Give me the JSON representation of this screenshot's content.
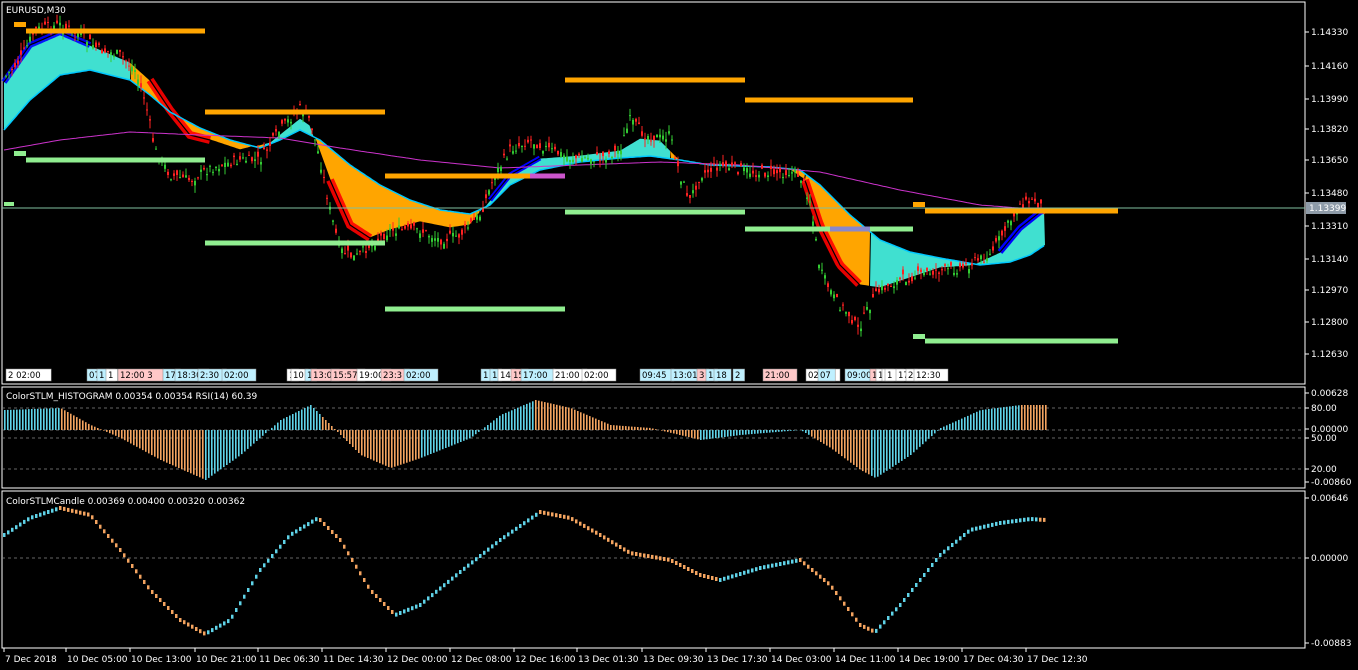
{
  "main": {
    "title": "EURUSD,M30",
    "price_labels": [
      "1.14330",
      "1.14160",
      "1.13990",
      "1.13820",
      "1.13650",
      "1.13480",
      "1.13310",
      "1.13140",
      "1.12970",
      "1.12800",
      "1.12630"
    ],
    "current_price": "1.13399",
    "session_tags": [
      {
        "text": "2 02:00",
        "bg": "#ffffff"
      },
      {
        "text": "07 0",
        "bg": "#bff0ff"
      },
      {
        "text": "1",
        "bg": "#bff0ff"
      },
      {
        "text": "1",
        "bg": "#ffffff"
      },
      {
        "text": "12:00 3",
        "bg": "#ffc8c8"
      },
      {
        "text": "17",
        "bg": "#bff0ff"
      },
      {
        "text": "18:30",
        "bg": "#bff0ff"
      },
      {
        "text": "2:30",
        "bg": "#bff0ff"
      },
      {
        "text": "02:00",
        "bg": "#bff0ff"
      },
      {
        "text": "1",
        "bg": "#ffffff"
      },
      {
        "text": "10",
        "bg": "#ffffff"
      },
      {
        "text": "1",
        "bg": "#bff0ff"
      },
      {
        "text": "13:0",
        "bg": "#ffc8c8"
      },
      {
        "text": "15:57",
        "bg": "#ffc8c8"
      },
      {
        "text": "19:00",
        "bg": "#ffffff"
      },
      {
        "text": "23:3",
        "bg": "#ffc8c8"
      },
      {
        "text": "02:00",
        "bg": "#bff0ff"
      },
      {
        "text": "1",
        "bg": "#bff0ff"
      },
      {
        "text": "1",
        "bg": "#bff0ff"
      },
      {
        "text": "14",
        "bg": "#ffffff"
      },
      {
        "text": "15",
        "bg": "#ffc8c8"
      },
      {
        "text": "17:00",
        "bg": "#bff0ff"
      },
      {
        "text": "21:00",
        "bg": "#ffffff"
      },
      {
        "text": "02:00",
        "bg": "#ffffff"
      },
      {
        "text": "09:45",
        "bg": "#bff0ff"
      },
      {
        "text": "13:01",
        "bg": "#bff0ff"
      },
      {
        "text": "3",
        "bg": "#ffc8c8"
      },
      {
        "text": "1",
        "bg": "#bff0ff"
      },
      {
        "text": "18",
        "bg": "#bff0ff"
      },
      {
        "text": "2",
        "bg": "#bff0ff"
      },
      {
        "text": "21:00",
        "bg": "#ffc8c8"
      },
      {
        "text": "02:00",
        "bg": "#ffffff"
      },
      {
        "text": "07",
        "bg": "#bff0ff"
      },
      {
        "text": "09:00",
        "bg": "#bff0ff"
      },
      {
        "text": "12:00",
        "bg": "#ffc8c8"
      },
      {
        "text": "1",
        "bg": "#ffffff"
      },
      {
        "text": "1",
        "bg": "#ffffff"
      },
      {
        "text": "1",
        "bg": "#ffffff"
      },
      {
        "text": "17:00",
        "bg": "#ffffff"
      },
      {
        "text": "2",
        "bg": "#ffffff"
      },
      {
        "text": "12:30",
        "bg": "#ffffff"
      }
    ]
  },
  "histogram": {
    "title": "ColorSTLM_HISTOGRAM 0.00354 0.00354 RSI(14) 60.39",
    "labels": [
      "0.00628",
      "80.00",
      "0.00000",
      "50.00",
      "20.00",
      "-0.00860"
    ]
  },
  "candle": {
    "title": "ColorSTLMCandle 0.00369 0.00400 0.00320 0.00362",
    "labels": [
      "0.00646",
      "0.00000",
      "-0.00883"
    ]
  },
  "time_axis": [
    "7 Dec 2018",
    "10 Dec 05:00",
    "10 Dec 13:00",
    "10 Dec 21:00",
    "11 Dec 06:30",
    "11 Dec 14:30",
    "12 Dec 00:00",
    "12 Dec 08:00",
    "12 Dec 16:00",
    "13 Dec 01:30",
    "13 Dec 09:30",
    "13 Dec 17:30",
    "14 Dec 03:00",
    "14 Dec 11:00",
    "14 Dec 19:00",
    "17 Dec 04:30",
    "17 Dec 12:30"
  ],
  "colors": {
    "orange": "#ffa500",
    "turquoise": "#40e0d0",
    "red": "#ff0000",
    "blue": "#0000ff",
    "green": "#00b000",
    "magenta": "#cc33cc",
    "lightgreen": "#90ee90",
    "sky": "#87ceeb",
    "hist_orange": "#f4a460",
    "hist_blue": "#5fd3e8"
  }
}
